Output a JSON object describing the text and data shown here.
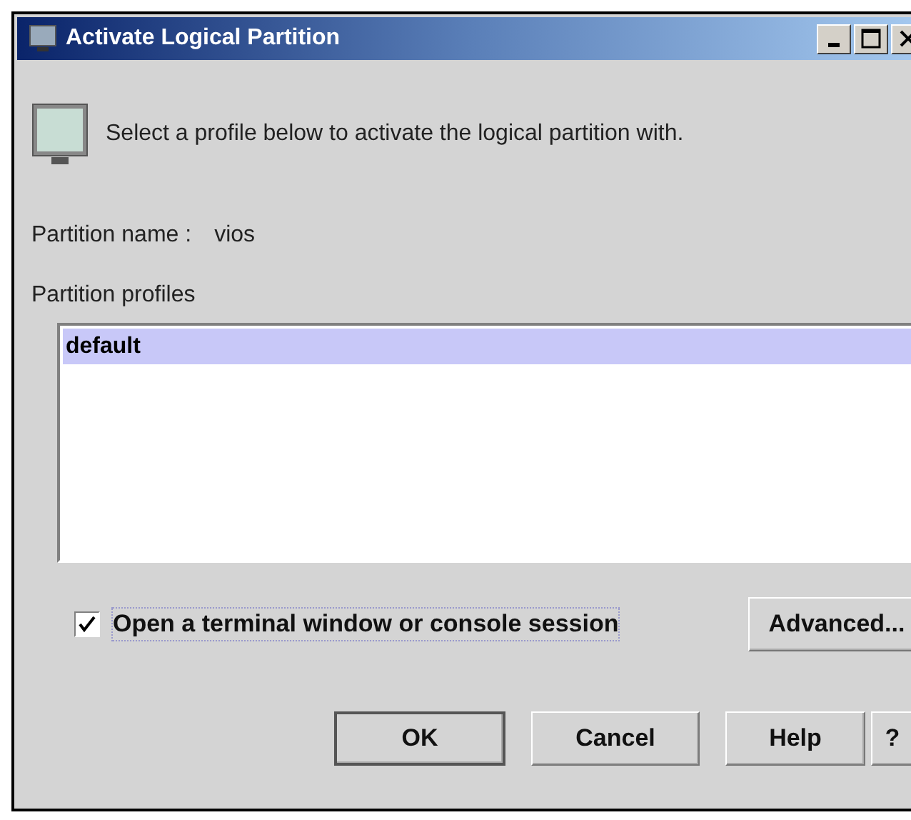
{
  "window": {
    "title": "Activate Logical Partition"
  },
  "instruction": "Select a profile below to activate the logical partition with.",
  "partition_name": {
    "label": "Partition name :",
    "value": "vios"
  },
  "profiles": {
    "label": "Partition profiles",
    "items": [
      {
        "label": "default",
        "selected": true
      }
    ]
  },
  "terminal_checkbox": {
    "label": "Open a terminal window or console session",
    "checked": true
  },
  "advanced_button": "Advanced...",
  "buttons": [
    {
      "label": "OK",
      "default": true
    },
    {
      "label": "Cancel",
      "default": false
    },
    {
      "label": "Help",
      "default": false
    },
    {
      "label": "?",
      "default": false
    }
  ]
}
